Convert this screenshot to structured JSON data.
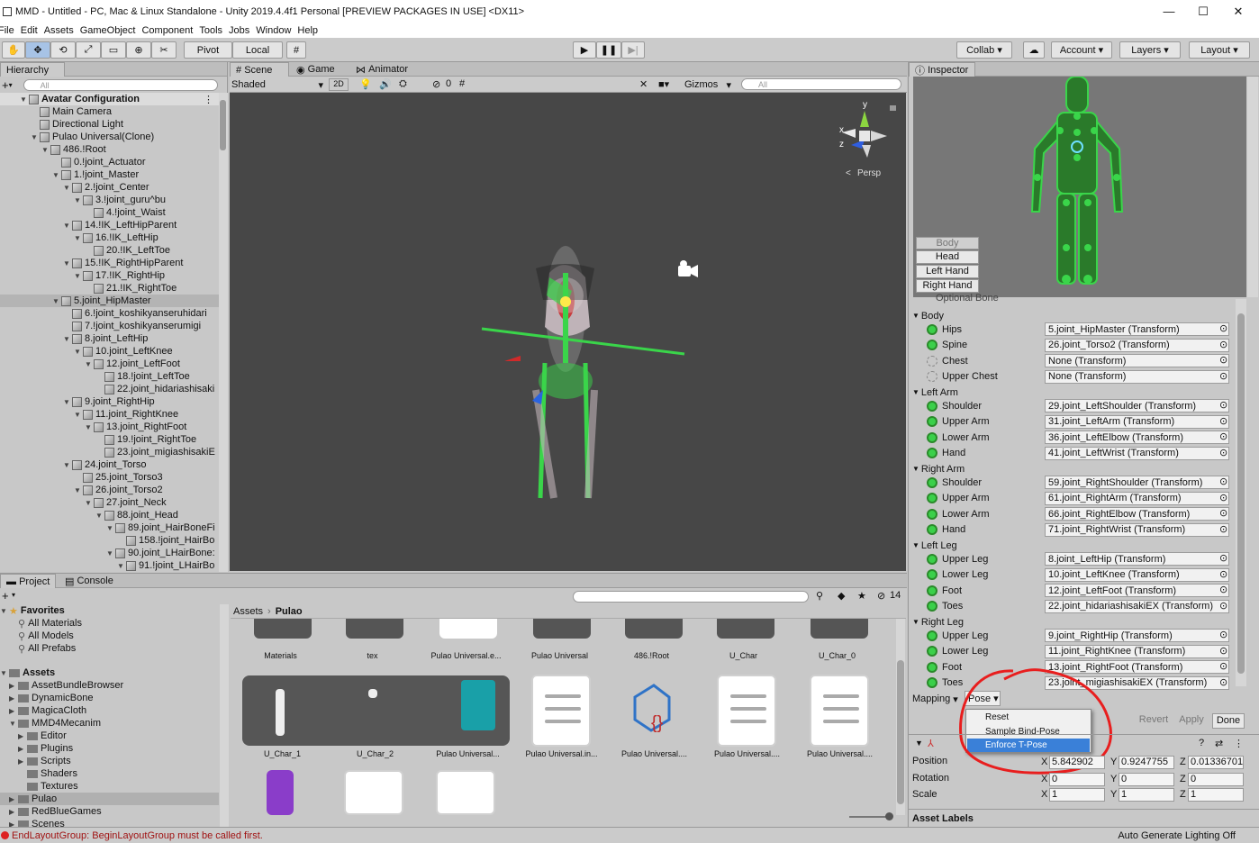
{
  "window": {
    "title": "MMD - Untitled - PC, Mac & Linux Standalone - Unity 2019.4.4f1 Personal [PREVIEW PACKAGES IN USE] <DX11>",
    "min": "—",
    "max": "☐",
    "close": "✕"
  },
  "menu": [
    "File",
    "Edit",
    "Assets",
    "GameObject",
    "Component",
    "Tools",
    "Jobs",
    "Window",
    "Help"
  ],
  "toolbar": {
    "pivot": "Pivot",
    "local": "Local",
    "collab": "Collab",
    "account": "Account",
    "layers": "Layers",
    "layout": "Layout"
  },
  "hierarchy": {
    "tab": "Hierarchy",
    "search_placeholder": "All",
    "plus": "+",
    "rows": [
      {
        "label": "Avatar Configuration",
        "indent": 0,
        "tri": "▼",
        "bold": true
      },
      {
        "label": "Main Camera",
        "indent": 1,
        "tri": ""
      },
      {
        "label": "Directional Light",
        "indent": 1,
        "tri": ""
      },
      {
        "label": "Pulao Universal(Clone)",
        "indent": 1,
        "tri": "▼"
      },
      {
        "label": "486.!Root",
        "indent": 2,
        "tri": "▼"
      },
      {
        "label": "0.!joint_Actuator",
        "indent": 3,
        "tri": ""
      },
      {
        "label": "1.!joint_Master",
        "indent": 3,
        "tri": "▼"
      },
      {
        "label": "2.!joint_Center",
        "indent": 4,
        "tri": "▼"
      },
      {
        "label": "3.!joint_guru^bu",
        "indent": 5,
        "tri": "▼"
      },
      {
        "label": "4.!joint_Waist",
        "indent": 6,
        "tri": ""
      },
      {
        "label": "14.!IK_LeftHipParent",
        "indent": 4,
        "tri": "▼"
      },
      {
        "label": "16.!IK_LeftHip",
        "indent": 5,
        "tri": "▼"
      },
      {
        "label": "20.!IK_LeftToe",
        "indent": 6,
        "tri": ""
      },
      {
        "label": "15.!IK_RightHipParent",
        "indent": 4,
        "tri": "▼"
      },
      {
        "label": "17.!IK_RightHip",
        "indent": 5,
        "tri": "▼"
      },
      {
        "label": "21.!IK_RightToe",
        "indent": 6,
        "tri": ""
      },
      {
        "label": "5.joint_HipMaster",
        "indent": 3,
        "tri": "▼",
        "selected": true
      },
      {
        "label": "6.!joint_koshikyanseruhidari",
        "indent": 4,
        "tri": ""
      },
      {
        "label": "7.!joint_koshikyanserumigi",
        "indent": 4,
        "tri": ""
      },
      {
        "label": "8.joint_LeftHip",
        "indent": 4,
        "tri": "▼"
      },
      {
        "label": "10.joint_LeftKnee",
        "indent": 5,
        "tri": "▼"
      },
      {
        "label": "12.joint_LeftFoot",
        "indent": 6,
        "tri": "▼"
      },
      {
        "label": "18.!joint_LeftToe",
        "indent": 7,
        "tri": ""
      },
      {
        "label": "22.joint_hidariashisaki",
        "indent": 7,
        "tri": ""
      },
      {
        "label": "9.joint_RightHip",
        "indent": 4,
        "tri": "▼"
      },
      {
        "label": "11.joint_RightKnee",
        "indent": 5,
        "tri": "▼"
      },
      {
        "label": "13.joint_RightFoot",
        "indent": 6,
        "tri": "▼"
      },
      {
        "label": "19.!joint_RightToe",
        "indent": 7,
        "tri": ""
      },
      {
        "label": "23.joint_migiashisakiE",
        "indent": 7,
        "tri": ""
      },
      {
        "label": "24.joint_Torso",
        "indent": 4,
        "tri": "▼"
      },
      {
        "label": "25.joint_Torso3",
        "indent": 5,
        "tri": ""
      },
      {
        "label": "26.joint_Torso2",
        "indent": 5,
        "tri": "▼"
      },
      {
        "label": "27.joint_Neck",
        "indent": 6,
        "tri": "▼"
      },
      {
        "label": "88.joint_Head",
        "indent": 7,
        "tri": "▼"
      },
      {
        "label": "89.joint_HairBoneFi",
        "indent": 8,
        "tri": "▼"
      },
      {
        "label": "158.!joint_HairBo",
        "indent": 9,
        "tri": ""
      },
      {
        "label": "90.joint_LHairBone:",
        "indent": 8,
        "tri": "▼"
      },
      {
        "label": "91.!joint_LHairBo",
        "indent": 9,
        "tri": "▼"
      }
    ]
  },
  "scene": {
    "tabs": [
      "Scene",
      "Game",
      "Animator"
    ],
    "shading": "Shaded",
    "mode2d": "2D",
    "hidden_count": "0",
    "gizmos": "Gizmos",
    "search_placeholder": "All",
    "persp": "Persp",
    "axis_x": "x",
    "axis_y": "y",
    "axis_z": "z"
  },
  "inspector": {
    "tab": "Inspector",
    "body_buttons": [
      "Body",
      "Head",
      "Left Hand",
      "Right Hand"
    ],
    "optional_bone": "Optional Bone",
    "groups": [
      {
        "title": "Body",
        "rows": [
          {
            "label": "Hips",
            "value": "5.joint_HipMaster (Transform)",
            "on": true
          },
          {
            "label": "Spine",
            "value": "26.joint_Torso2 (Transform)",
            "on": true
          },
          {
            "label": "Chest",
            "value": "None (Transform)",
            "on": false
          },
          {
            "label": "Upper Chest",
            "value": "None (Transform)",
            "on": false
          }
        ]
      },
      {
        "title": "Left Arm",
        "rows": [
          {
            "label": "Shoulder",
            "value": "29.joint_LeftShoulder (Transform)",
            "on": true
          },
          {
            "label": "Upper Arm",
            "value": "31.joint_LeftArm (Transform)",
            "on": true
          },
          {
            "label": "Lower Arm",
            "value": "36.joint_LeftElbow (Transform)",
            "on": true
          },
          {
            "label": "Hand",
            "value": "41.joint_LeftWrist (Transform)",
            "on": true
          }
        ]
      },
      {
        "title": "Right Arm",
        "rows": [
          {
            "label": "Shoulder",
            "value": "59.joint_RightShoulder (Transform)",
            "on": true
          },
          {
            "label": "Upper Arm",
            "value": "61.joint_RightArm (Transform)",
            "on": true
          },
          {
            "label": "Lower Arm",
            "value": "66.joint_RightElbow (Transform)",
            "on": true
          },
          {
            "label": "Hand",
            "value": "71.joint_RightWrist (Transform)",
            "on": true
          }
        ]
      },
      {
        "title": "Left Leg",
        "rows": [
          {
            "label": "Upper Leg",
            "value": "8.joint_LeftHip (Transform)",
            "on": true
          },
          {
            "label": "Lower Leg",
            "value": "10.joint_LeftKnee (Transform)",
            "on": true
          },
          {
            "label": "Foot",
            "value": "12.joint_LeftFoot (Transform)",
            "on": true
          },
          {
            "label": "Toes",
            "value": "22.joint_hidariashisakiEX (Transform)",
            "on": true
          }
        ]
      },
      {
        "title": "Right Leg",
        "rows": [
          {
            "label": "Upper Leg",
            "value": "9.joint_RightHip (Transform)",
            "on": true
          },
          {
            "label": "Lower Leg",
            "value": "11.joint_RightKnee (Transform)",
            "on": true
          },
          {
            "label": "Foot",
            "value": "13.joint_RightFoot (Transform)",
            "on": true
          },
          {
            "label": "Toes",
            "value": "23.joint_migiashisakiEX (Transform)",
            "on": true
          }
        ]
      }
    ],
    "mapping": "Mapping",
    "pose": "Pose",
    "pose_menu": [
      "Reset",
      "Sample Bind-Pose",
      "Enforce T-Pose"
    ],
    "revert": "Revert",
    "apply": "Apply",
    "done": "Done",
    "transform": {
      "position_label": "Position",
      "rotation_label": "Rotation",
      "scale_label": "Scale",
      "position": {
        "x": "5.842902",
        "y": "0.9247755",
        "z": "0.01336701"
      },
      "rotation": {
        "x": "0",
        "y": "0",
        "z": "0"
      },
      "scale": {
        "x": "1",
        "y": "1",
        "z": "1"
      }
    },
    "asset_labels": "Asset Labels"
  },
  "project": {
    "tabs": [
      "Project",
      "Console"
    ],
    "favorites": {
      "title": "Favorites",
      "items": [
        "All Materials",
        "All Models",
        "All Prefabs"
      ]
    },
    "assets": {
      "title": "Assets",
      "items": [
        "AssetBundleBrowser",
        "DynamicBone",
        "MagicaCloth",
        "MMD4Mecanim",
        "Editor",
        "Plugins",
        "Scripts",
        "Shaders",
        "Textures",
        "Pulao",
        "RedBlueGames",
        "Scenes"
      ]
    },
    "breadcrumb": [
      "Assets",
      "Pulao"
    ],
    "hidden_count": "14",
    "row1": [
      "Materials",
      "tex",
      "Pulao Universal.e...",
      "Pulao Universal",
      "486.!Root",
      "U_Char",
      "U_Char_0"
    ],
    "row2": [
      "U_Char_1",
      "U_Char_2",
      "Pulao Universal...",
      "Pulao Universal.in...",
      "Pulao Universal....",
      "Pulao Universal....",
      "Pulao Universal...."
    ]
  },
  "status": {
    "error": "EndLayoutGroup: BeginLayoutGroup must be called first.",
    "lighting": "Auto Generate Lighting Off"
  }
}
